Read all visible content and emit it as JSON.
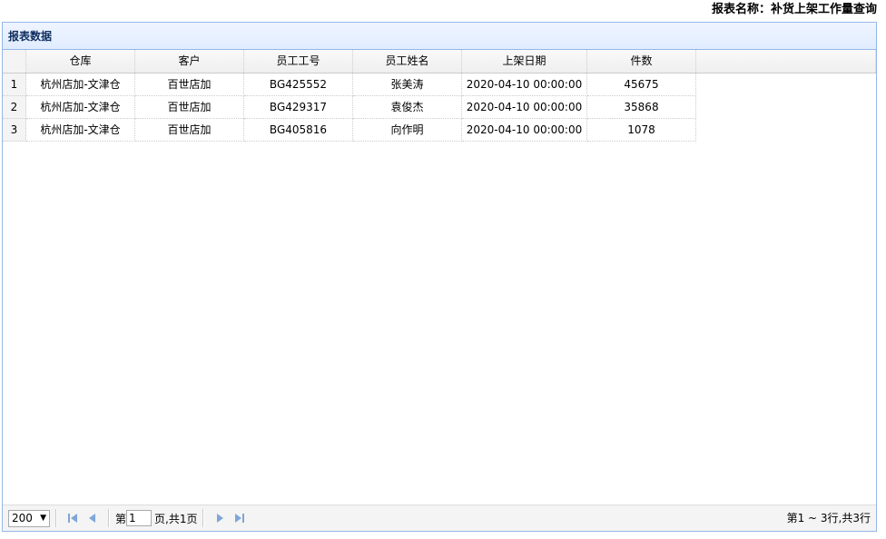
{
  "report": {
    "title": "报表名称：补货上架工作量查询"
  },
  "panel": {
    "title": "报表数据"
  },
  "columns": [
    "仓库",
    "客户",
    "员工工号",
    "员工姓名",
    "上架日期",
    "件数"
  ],
  "rows": [
    {
      "n": "1",
      "c": [
        "杭州店加-文津仓",
        "百世店加",
        "BG425552",
        "张美涛",
        "2020-04-10 00:00:00",
        "45675"
      ]
    },
    {
      "n": "2",
      "c": [
        "杭州店加-文津仓",
        "百世店加",
        "BG429317",
        "袁俊杰",
        "2020-04-10 00:00:00",
        "35868"
      ]
    },
    {
      "n": "3",
      "c": [
        "杭州店加-文津仓",
        "百世店加",
        "BG405816",
        "向作明",
        "2020-04-10 00:00:00",
        "1078"
      ]
    }
  ],
  "pager": {
    "page_size": "200",
    "page_prefix": "第",
    "page_value": "1",
    "page_suffix": "页,共1页",
    "info": "第1 ~ 3行,共3行"
  },
  "colors": {
    "border": "#95b8e7",
    "header_text": "#0e2d5f",
    "nav_icon": "#7fa6d8"
  }
}
